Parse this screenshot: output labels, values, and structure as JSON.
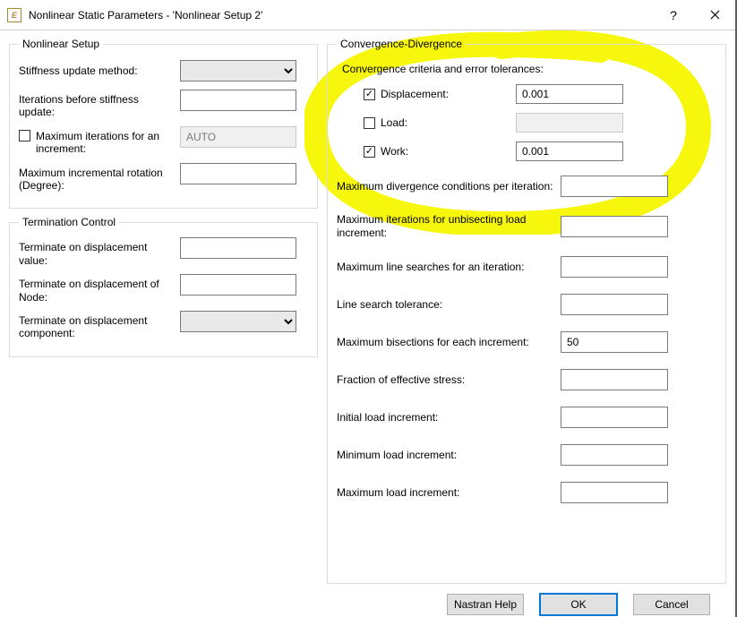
{
  "window": {
    "title": "Nonlinear Static Parameters - 'Nonlinear Setup 2'"
  },
  "nonlinear_setup": {
    "legend": "Nonlinear Setup",
    "stiffness_label": "Stiffness update method:",
    "iter_before_label": "Iterations before stiffness update:",
    "iter_before_value": "",
    "max_iter_check_label": "Maximum iterations for an increment:",
    "max_iter_value": "AUTO",
    "max_rot_label": "Maximum incremental rotation (Degree):",
    "max_rot_value": ""
  },
  "termination": {
    "legend": "Termination Control",
    "disp_value_label": "Terminate on displacement value:",
    "disp_value": "",
    "disp_node_label": "Terminate on displacement of Node:",
    "disp_node": "",
    "disp_comp_label": "Terminate on displacement component:"
  },
  "convergence": {
    "legend": "Convergence-Divergence",
    "criteria_label": "Convergence criteria and error tolerances:",
    "items": [
      {
        "label": "Displacement:",
        "checked": true,
        "value": "0.001"
      },
      {
        "label": "Load:",
        "checked": false,
        "value": ""
      },
      {
        "label": "Work:",
        "checked": true,
        "value": "0.001"
      }
    ],
    "rows": {
      "max_div": {
        "label": "Maximum divergence conditions per iteration:",
        "value": ""
      },
      "max_iter_unbi": {
        "label": "Maximum iterations for unbisecting load increment:",
        "value": ""
      },
      "max_line": {
        "label": "Maximum line searches for an iteration:",
        "value": ""
      },
      "line_tol": {
        "label": "Line search tolerance:",
        "value": ""
      },
      "max_bisect": {
        "label": "Maximum bisections for each increment:",
        "value": "50"
      },
      "frac_stress": {
        "label": "Fraction of effective stress:",
        "value": ""
      },
      "init_inc": {
        "label": "Initial load increment:",
        "value": ""
      },
      "min_inc": {
        "label": "Minimum load increment:",
        "value": ""
      },
      "max_inc": {
        "label": "Maximum load increment:",
        "value": ""
      }
    }
  },
  "buttons": {
    "help": "Nastran Help",
    "ok": "OK",
    "cancel": "Cancel"
  }
}
